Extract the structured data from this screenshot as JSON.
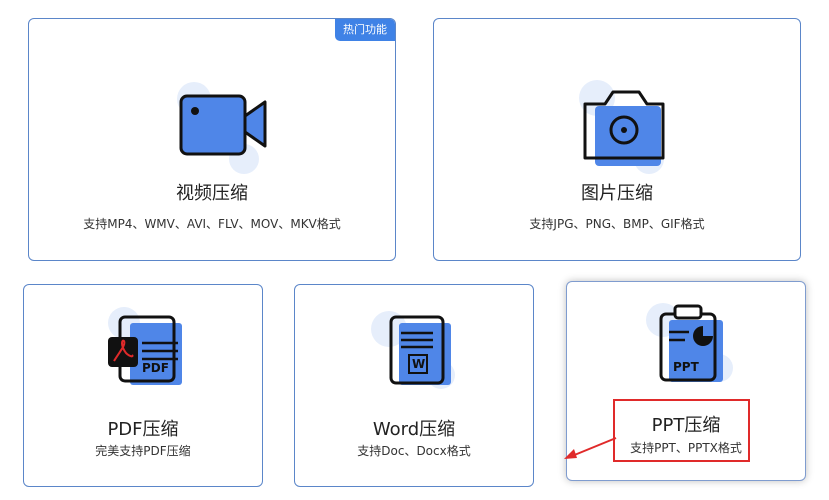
{
  "cards": {
    "video": {
      "title": "视频压缩",
      "desc": "支持MP4、WMV、AVI、FLV、MOV、MKV格式",
      "badge": "热门功能"
    },
    "image": {
      "title": "图片压缩",
      "desc": "支持JPG、PNG、BMP、GIF格式"
    },
    "pdf": {
      "title": "PDF压缩",
      "desc": "完美支持PDF压缩",
      "icon_text": "PDF"
    },
    "word": {
      "title": "Word压缩",
      "desc": "支持Doc、Docx格式",
      "icon_text": "W"
    },
    "ppt": {
      "title": "PPT压缩",
      "desc": "支持PPT、PPTX格式",
      "icon_text": "PPT"
    }
  },
  "colors": {
    "accent": "#3f82e6",
    "icon_fill": "#4f86e8",
    "blob": "#e6eefb",
    "annotation": "#e02a2a"
  }
}
